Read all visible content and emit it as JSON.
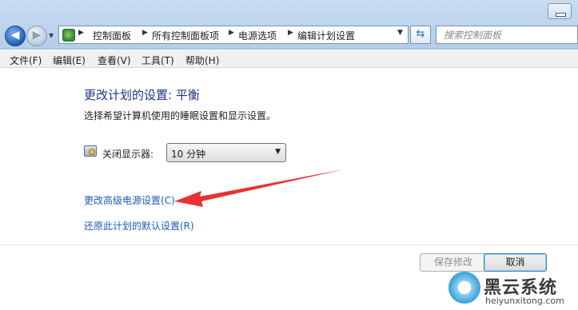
{
  "address_bar": {
    "breadcrumbs": [
      "控制面板",
      "所有控制面板项",
      "电源选项",
      "编辑计划设置"
    ]
  },
  "search": {
    "placeholder": "搜索控制面板"
  },
  "menu": [
    "文件(F)",
    "编辑(E)",
    "查看(V)",
    "工具(T)",
    "帮助(H)"
  ],
  "main": {
    "heading": "更改计划的设置: 平衡",
    "subtext": "选择希望计算机使用的睡眠设置和显示设置。",
    "display_off": {
      "label": "关闭显示器:",
      "value": "10 分钟"
    },
    "link_advanced": "更改高级电源设置(C)",
    "link_restore": "还原此计划的默认设置(R)"
  },
  "buttons": {
    "save": "保存修改",
    "cancel": "取消"
  },
  "watermark": {
    "title": "黑云系统",
    "url": "heiyunxitong.com"
  },
  "colors": {
    "link": "#1e5bb8",
    "heading": "#1e3287",
    "annotation_arrow": "#e8322f"
  }
}
